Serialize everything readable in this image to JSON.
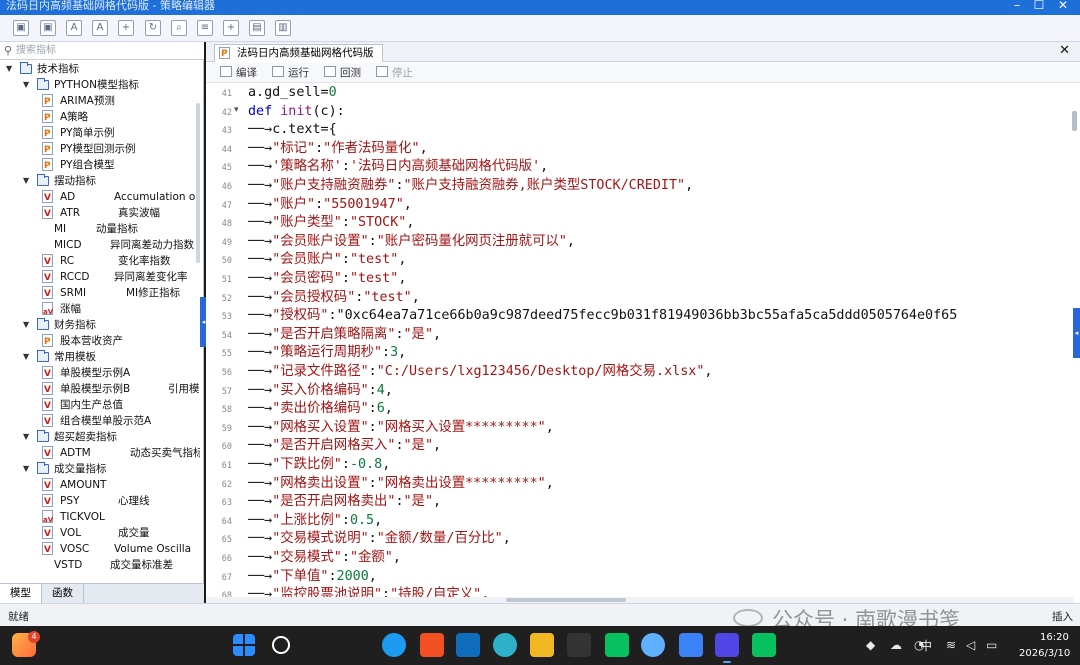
{
  "window": {
    "title": "法码日内高频基础网格代码版 - 策略编辑器",
    "controls": [
      "–",
      "☐",
      "✕"
    ]
  },
  "toolbar": {
    "icons": [
      "save-icon",
      "save-as-icon",
      "font-decrease-icon",
      "font-increase-icon",
      "import-icon",
      "export-icon",
      "find-icon",
      "format-icon",
      "new-icon",
      "copy-icon",
      "paste-icon"
    ],
    "glyphs": [
      "▣",
      "▣",
      "A",
      "A",
      "+",
      "↻",
      "⌕",
      "≡",
      "+",
      "▤",
      "▥"
    ]
  },
  "left_panel": {
    "search_placeholder": "搜索指标",
    "tree": [
      {
        "level": 0,
        "type": "folder",
        "label": "技术指标",
        "toggle": "▼"
      },
      {
        "level": 1,
        "type": "folder",
        "label": "PYTHON模型指标",
        "toggle": "▼"
      },
      {
        "level": 2,
        "type": "file",
        "icon": "P",
        "label": "ARIMA预测",
        "desc": ""
      },
      {
        "level": 2,
        "type": "file",
        "icon": "P",
        "label": "A策略",
        "desc": ""
      },
      {
        "level": 2,
        "type": "file",
        "icon": "P",
        "label": "PY简单示例",
        "desc": ""
      },
      {
        "level": 2,
        "type": "file",
        "icon": "P",
        "label": "PY模型回测示例",
        "desc": ""
      },
      {
        "level": 2,
        "type": "file",
        "icon": "P",
        "label": "PY组合模型",
        "desc": ""
      },
      {
        "level": 1,
        "type": "folder",
        "label": "摆动指标",
        "toggle": "▼"
      },
      {
        "level": 2,
        "type": "file",
        "icon": "V",
        "label": "AD",
        "desc": "Accumulation or"
      },
      {
        "level": 2,
        "type": "file",
        "icon": "V",
        "label": "ATR",
        "desc": "真实波幅"
      },
      {
        "level": 2,
        "type": "plain",
        "icon": "",
        "label": "MI",
        "desc": "动量指标"
      },
      {
        "level": 2,
        "type": "plain",
        "icon": "",
        "label": "MICD",
        "desc": "异同离差动力指数"
      },
      {
        "level": 2,
        "type": "file",
        "icon": "V",
        "label": "RC",
        "desc": "变化率指数"
      },
      {
        "level": 2,
        "type": "file",
        "icon": "V",
        "label": "RCCD",
        "desc": "异同离差变化率"
      },
      {
        "level": 2,
        "type": "file",
        "icon": "V",
        "label": "SRMI",
        "desc": "MI修正指标"
      },
      {
        "level": 2,
        "type": "file",
        "icon": "aV",
        "label": "涨幅",
        "desc": ""
      },
      {
        "level": 1,
        "type": "folder",
        "label": "财务指标",
        "toggle": "▼"
      },
      {
        "level": 2,
        "type": "file",
        "icon": "P",
        "label": "股本营收资产",
        "desc": ""
      },
      {
        "level": 1,
        "type": "folder",
        "label": "常用模板",
        "toggle": "▼"
      },
      {
        "level": 2,
        "type": "file",
        "icon": "V",
        "label": "单股模型示例A",
        "desc": ""
      },
      {
        "level": 2,
        "type": "file",
        "icon": "V",
        "label": "单股模型示例B",
        "desc": "引用模"
      },
      {
        "level": 2,
        "type": "file",
        "icon": "V",
        "label": "国内生产总值",
        "desc": ""
      },
      {
        "level": 2,
        "type": "file",
        "icon": "V",
        "label": "组合模型单股示范A",
        "desc": ""
      },
      {
        "level": 1,
        "type": "folder",
        "label": "超买超卖指标",
        "toggle": "▼"
      },
      {
        "level": 2,
        "type": "file",
        "icon": "V",
        "label": "ADTM",
        "desc": "动态买卖气指标"
      },
      {
        "level": 1,
        "type": "folder",
        "label": "成交量指标",
        "toggle": "▼"
      },
      {
        "level": 2,
        "type": "file",
        "icon": "V",
        "label": "AMOUNT",
        "desc": ""
      },
      {
        "level": 2,
        "type": "file",
        "icon": "V",
        "label": "PSY",
        "desc": "心理线"
      },
      {
        "level": 2,
        "type": "file",
        "icon": "aV",
        "label": "TICKVOL",
        "desc": ""
      },
      {
        "level": 2,
        "type": "file",
        "icon": "V",
        "label": "VOL",
        "desc": "成交量"
      },
      {
        "level": 2,
        "type": "file",
        "icon": "V",
        "label": "VOSC",
        "desc": "Volume Oscilla"
      },
      {
        "level": 2,
        "type": "plain",
        "icon": "",
        "label": "VSTD",
        "desc": "成交量标准差"
      }
    ],
    "tabs": [
      {
        "label": "模型",
        "active": true
      },
      {
        "label": "函数",
        "active": false
      }
    ]
  },
  "editor": {
    "doc_tab": "法码日内高频基础网格代码版",
    "close_glyph": "✕",
    "actions": [
      {
        "label": "编译",
        "enabled": true
      },
      {
        "label": "运行",
        "enabled": true
      },
      {
        "label": "回测",
        "enabled": true
      },
      {
        "label": "停止",
        "enabled": false
      }
    ],
    "lines": [
      {
        "n": "41",
        "fold": "",
        "indent": 0,
        "code": "a.gd_sell=0"
      },
      {
        "n": "42",
        "fold": "▾",
        "indent": 0,
        "code": "def init(c):"
      },
      {
        "n": "43",
        "fold": "",
        "indent": 1,
        "code": "c.text={"
      },
      {
        "n": "44",
        "fold": "",
        "indent": 1,
        "code": "\"标记\":\"作者法码量化\","
      },
      {
        "n": "45",
        "fold": "",
        "indent": 1,
        "code": "'策略名称':'法码日内高频基础网格代码版',"
      },
      {
        "n": "46",
        "fold": "",
        "indent": 1,
        "code": "\"账户支持融资融券\":\"账户支持融资融券,账户类型STOCK/CREDIT\","
      },
      {
        "n": "47",
        "fold": "",
        "indent": 1,
        "code": "\"账户\":\"55001947\","
      },
      {
        "n": "48",
        "fold": "",
        "indent": 1,
        "code": "\"账户类型\":\"STOCK\","
      },
      {
        "n": "49",
        "fold": "",
        "indent": 1,
        "code": "\"会员账户设置\":\"账户密码量化网页注册就可以\","
      },
      {
        "n": "50",
        "fold": "",
        "indent": 1,
        "code": "\"会员账户\":\"test\","
      },
      {
        "n": "51",
        "fold": "",
        "indent": 1,
        "code": "\"会员密码\":\"test\","
      },
      {
        "n": "52",
        "fold": "",
        "indent": 1,
        "code": "\"会员授权码\":\"test\","
      },
      {
        "n": "53",
        "fold": "",
        "indent": 1,
        "code": "\"授权码\":\"0xc64ea7a71ce66b0a9c987deed75fecc9b031f81949036bb3bc55afa5ca5ddd0505764e0f65"
      },
      {
        "n": "54",
        "fold": "",
        "indent": 1,
        "code": "\"是否开启策略隔离\":\"是\","
      },
      {
        "n": "55",
        "fold": "",
        "indent": 1,
        "code": "\"策略运行周期秒\":3,"
      },
      {
        "n": "56",
        "fold": "",
        "indent": 1,
        "code": "\"记录文件路径\":\"C:/Users/lxg123456/Desktop/网格交易.xlsx\","
      },
      {
        "n": "57",
        "fold": "",
        "indent": 1,
        "code": "\"买入价格编码\":4,"
      },
      {
        "n": "58",
        "fold": "",
        "indent": 1,
        "code": "\"卖出价格编码\":6,"
      },
      {
        "n": "59",
        "fold": "",
        "indent": 1,
        "code": "\"网格买入设置\":\"网格买入设置*********\","
      },
      {
        "n": "60",
        "fold": "",
        "indent": 1,
        "code": "\"是否开启网格买入\":\"是\","
      },
      {
        "n": "61",
        "fold": "",
        "indent": 1,
        "code": "\"下跌比例\":-0.8,"
      },
      {
        "n": "62",
        "fold": "",
        "indent": 1,
        "code": "\"网格卖出设置\":\"网格卖出设置*********\","
      },
      {
        "n": "63",
        "fold": "",
        "indent": 1,
        "code": "\"是否开启网格卖出\":\"是\","
      },
      {
        "n": "64",
        "fold": "",
        "indent": 1,
        "code": "\"上涨比例\":0.5,"
      },
      {
        "n": "65",
        "fold": "",
        "indent": 1,
        "code": "\"交易模式说明\":\"金额/数量/百分比\","
      },
      {
        "n": "66",
        "fold": "",
        "indent": 1,
        "code": "\"交易模式\":\"金额\","
      },
      {
        "n": "67",
        "fold": "",
        "indent": 1,
        "code": "\"下单值\":2000,"
      },
      {
        "n": "68",
        "fold": "",
        "indent": 1,
        "code": "\"监控股票池说明\":\"持股/自定义\","
      }
    ]
  },
  "statusbar": {
    "left": "就绪",
    "right": "插入",
    "watermark": "公众号 · 南歌漫书笺"
  },
  "taskbar": {
    "weather_badge": "4",
    "tray_language": "中",
    "time": "16:20",
    "date": "2026/3/10",
    "apps": [
      "windows-start-icon",
      "search-icon",
      "task-view-icon",
      "edge-icon",
      "store-icon",
      "outlook-icon",
      "edge-dev-icon",
      "file-explorer-icon",
      "app-black-icon",
      "wechat-green-icon",
      "browser-icon",
      "trading-app-icon",
      "search-app-icon",
      "wechat-icon"
    ],
    "colors": [
      "#0a84ff",
      "#ffffff",
      "#ffffff",
      "#1d9bf0",
      "#f25022",
      "#0f6cbd",
      "#2fb0c9",
      "#f2b824",
      "#333333",
      "#07c160",
      "#5fb0ff",
      "#3b82f6",
      "#4f46e5",
      "#07c160"
    ]
  }
}
